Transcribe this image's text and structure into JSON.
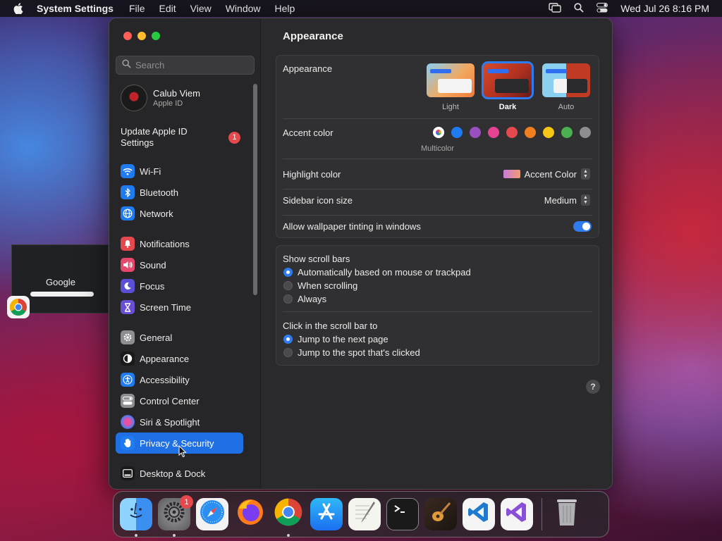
{
  "menubar": {
    "app_name": "System Settings",
    "items": [
      "File",
      "Edit",
      "View",
      "Window",
      "Help"
    ],
    "clock": "Wed Jul 26  8:16 PM"
  },
  "sidebar": {
    "search_placeholder": "Search",
    "profile": {
      "name": "Calub Viem",
      "subtitle": "Apple ID"
    },
    "update": {
      "label": "Update Apple ID Settings",
      "badge": "1"
    },
    "groups": [
      [
        {
          "label": "Wi-Fi",
          "icon": "wifi-icon",
          "color": "#1f7bf0"
        },
        {
          "label": "Bluetooth",
          "icon": "bluetooth-icon",
          "color": "#1f7bf0"
        },
        {
          "label": "Network",
          "icon": "globe-icon",
          "color": "#1f7bf0"
        }
      ],
      [
        {
          "label": "Notifications",
          "icon": "bell-icon",
          "color": "#e5484d"
        },
        {
          "label": "Sound",
          "icon": "speaker-icon",
          "color": "#e5486d"
        },
        {
          "label": "Focus",
          "icon": "moon-icon",
          "color": "#5b4fd6"
        },
        {
          "label": "Screen Time",
          "icon": "hourglass-icon",
          "color": "#6a4fd6"
        }
      ],
      [
        {
          "label": "General",
          "icon": "gear-icon",
          "color": "#8e8e92"
        },
        {
          "label": "Appearance",
          "icon": "appearance-icon",
          "color": "#1a1a1a"
        },
        {
          "label": "Accessibility",
          "icon": "accessibility-icon",
          "color": "#1f7bf0"
        },
        {
          "label": "Control Center",
          "icon": "control-center-icon",
          "color": "#8e8e92"
        },
        {
          "label": "Siri & Spotlight",
          "icon": "siri-icon",
          "color": "#b0489e"
        },
        {
          "label": "Privacy & Security",
          "icon": "hand-icon",
          "color": "#1f7bf0",
          "selected": true
        }
      ],
      [
        {
          "label": "Desktop & Dock",
          "icon": "dock-icon",
          "color": "#1a1a1a"
        }
      ]
    ]
  },
  "content": {
    "title": "Appearance",
    "appearance": {
      "label": "Appearance",
      "options": [
        {
          "label": "Light",
          "selected": false
        },
        {
          "label": "Dark",
          "selected": true
        },
        {
          "label": "Auto",
          "selected": false
        }
      ]
    },
    "accent": {
      "label": "Accent color",
      "multicolor_caption": "Multicolor",
      "colors": [
        "#8e8e92",
        "#1f7bf0",
        "#9a4fc0",
        "#e84393",
        "#e5484d",
        "#f0801f",
        "#f5c518",
        "#4caf50",
        "#8e8e92"
      ]
    },
    "highlight": {
      "label": "Highlight color",
      "value": "Accent Color"
    },
    "icon_size": {
      "label": "Sidebar icon size",
      "value": "Medium"
    },
    "tinting": {
      "label": "Allow wallpaper tinting in windows",
      "enabled": true
    },
    "scroll_bars": {
      "label": "Show scroll bars",
      "options": [
        {
          "label": "Automatically based on mouse or trackpad",
          "selected": true
        },
        {
          "label": "When scrolling",
          "selected": false
        },
        {
          "label": "Always",
          "selected": false
        }
      ]
    },
    "click_scroll": {
      "label": "Click in the scroll bar to",
      "options": [
        {
          "label": "Jump to the next page",
          "selected": true
        },
        {
          "label": "Jump to the spot that's clicked",
          "selected": false
        }
      ]
    },
    "help": "?"
  },
  "desktop": {
    "chrome_thumb_text": "Google"
  },
  "dock": {
    "apps": [
      {
        "name": "finder",
        "icon": "finder-icon",
        "running": true
      },
      {
        "name": "system-settings",
        "icon": "gear-icon",
        "running": true,
        "badge": "1"
      },
      {
        "name": "safari",
        "icon": "compass-icon",
        "running": false
      },
      {
        "name": "firefox",
        "icon": "firefox-icon",
        "running": false
      },
      {
        "name": "chrome",
        "icon": "chrome-icon",
        "running": true
      },
      {
        "name": "app-store",
        "icon": "app-store-icon",
        "running": false
      },
      {
        "name": "textedit",
        "icon": "pencil-icon",
        "running": false
      },
      {
        "name": "terminal",
        "icon": "terminal-icon",
        "running": false
      },
      {
        "name": "garageband",
        "icon": "guitar-icon",
        "running": false
      },
      {
        "name": "vscode",
        "icon": "vscode-icon",
        "running": false
      },
      {
        "name": "visual-studio",
        "icon": "visual-studio-icon",
        "running": false
      },
      {
        "name": "trash",
        "icon": "trash-icon",
        "running": false
      }
    ]
  }
}
